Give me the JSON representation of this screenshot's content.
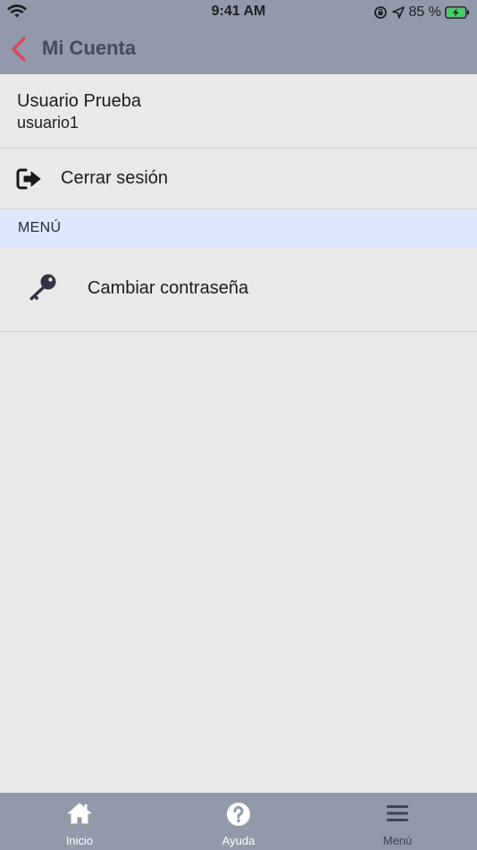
{
  "status_bar": {
    "time": "9:41 AM",
    "battery_percent": "85 %",
    "battery_level": 0.85,
    "icons": [
      "wifi-icon",
      "orientation-lock-icon",
      "location-arrow-icon",
      "battery-charging-icon"
    ]
  },
  "nav": {
    "title": "Mi Cuenta",
    "back_icon": "chevron-left-icon",
    "accent_color": "#d9475a"
  },
  "user": {
    "name": "Usuario Prueba",
    "login": "usuario1"
  },
  "logout": {
    "label": "Cerrar sesión",
    "icon": "sign-out-icon"
  },
  "menu_section": {
    "title": "MENÚ",
    "items": [
      {
        "label": "Cambiar contraseña",
        "icon": "key-icon"
      }
    ]
  },
  "tabbar": {
    "tabs": [
      {
        "label": "Inicio",
        "icon": "home-icon"
      },
      {
        "label": "Ayuda",
        "icon": "help-icon"
      },
      {
        "label": "Menú",
        "icon": "menu-icon"
      }
    ]
  },
  "colors": {
    "header_bg": "#9199aa",
    "body_bg": "#e9e9e9",
    "section_bg": "#dce7fb",
    "tab_active": "#ffffff",
    "tab_inactive": "#3e4452"
  }
}
